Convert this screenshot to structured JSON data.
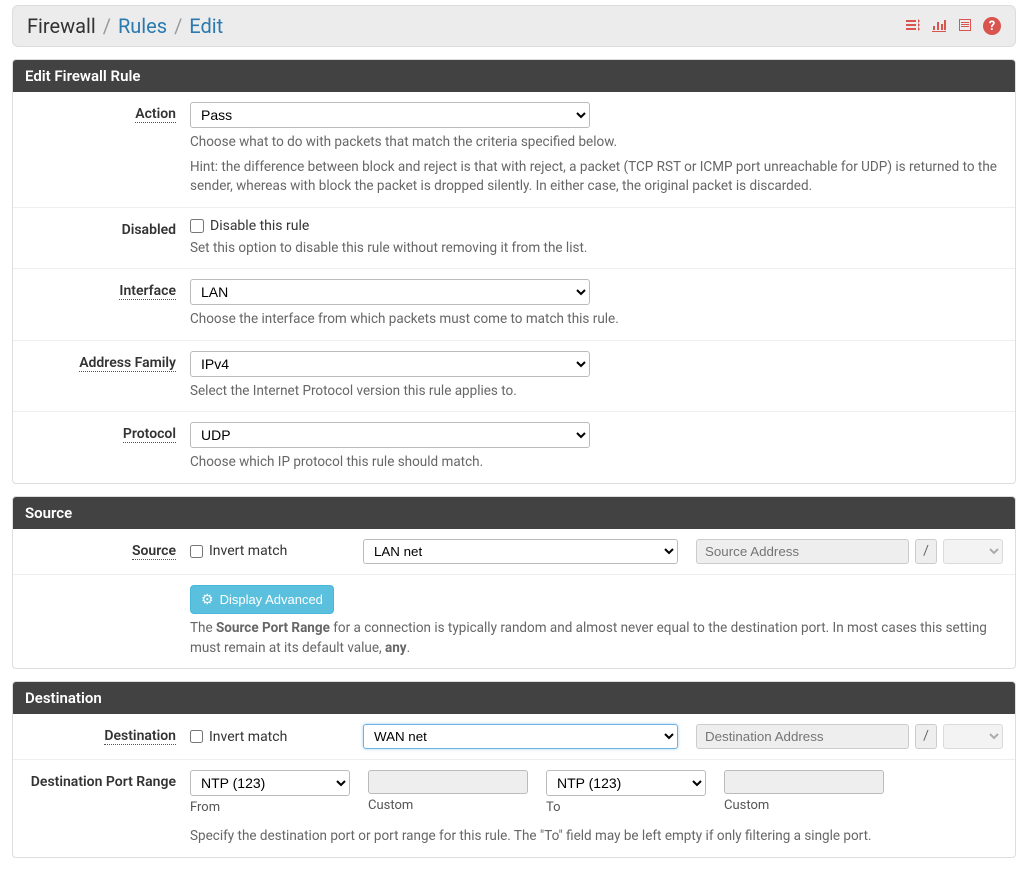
{
  "breadcrumb": {
    "root": "Firewall",
    "rules": "Rules",
    "edit": "Edit",
    "sep": "/"
  },
  "panels": {
    "edit_rule": "Edit Firewall Rule",
    "source": "Source",
    "destination": "Destination"
  },
  "labels": {
    "action": "Action",
    "disabled": "Disabled",
    "interface": "Interface",
    "address_family": "Address Family",
    "protocol": "Protocol",
    "source": "Source",
    "destination": "Destination",
    "dest_port_range": "Destination Port Range"
  },
  "fields": {
    "action": {
      "value": "Pass",
      "hint": "Choose what to do with packets that match the criteria specified below.",
      "hint2": "Hint: the difference between block and reject is that with reject, a packet (TCP RST or ICMP port unreachable for UDP) is returned to the sender, whereas with block the packet is dropped silently. In either case, the original packet is discarded."
    },
    "disabled": {
      "checkbox_label": "Disable this rule",
      "hint": "Set this option to disable this rule without removing it from the list."
    },
    "interface": {
      "value": "LAN",
      "hint": "Choose the interface from which packets must come to match this rule."
    },
    "address_family": {
      "value": "IPv4",
      "hint": "Select the Internet Protocol version this rule applies to."
    },
    "protocol": {
      "value": "UDP",
      "hint": "Choose which IP protocol this rule should match."
    }
  },
  "source": {
    "invert_label": "Invert match",
    "type_value": "LAN net",
    "addr_placeholder": "Source Address",
    "slash": "/",
    "display_advanced": "Display Advanced",
    "hint_pre": "The ",
    "hint_bold1": "Source Port Range",
    "hint_mid": " for a connection is typically random and almost never equal to the destination port. In most cases this setting must remain at its default value, ",
    "hint_bold2": "any",
    "hint_end": "."
  },
  "destination": {
    "invert_label": "Invert match",
    "type_value": "WAN net",
    "addr_placeholder": "Destination Address",
    "slash": "/",
    "port_from_value": "NTP (123)",
    "port_to_value": "NTP (123)",
    "sub_from": "From",
    "sub_custom": "Custom",
    "sub_to": "To",
    "hint": "Specify the destination port or port range for this rule. The \"To\" field may be left empty if only filtering a single port."
  }
}
